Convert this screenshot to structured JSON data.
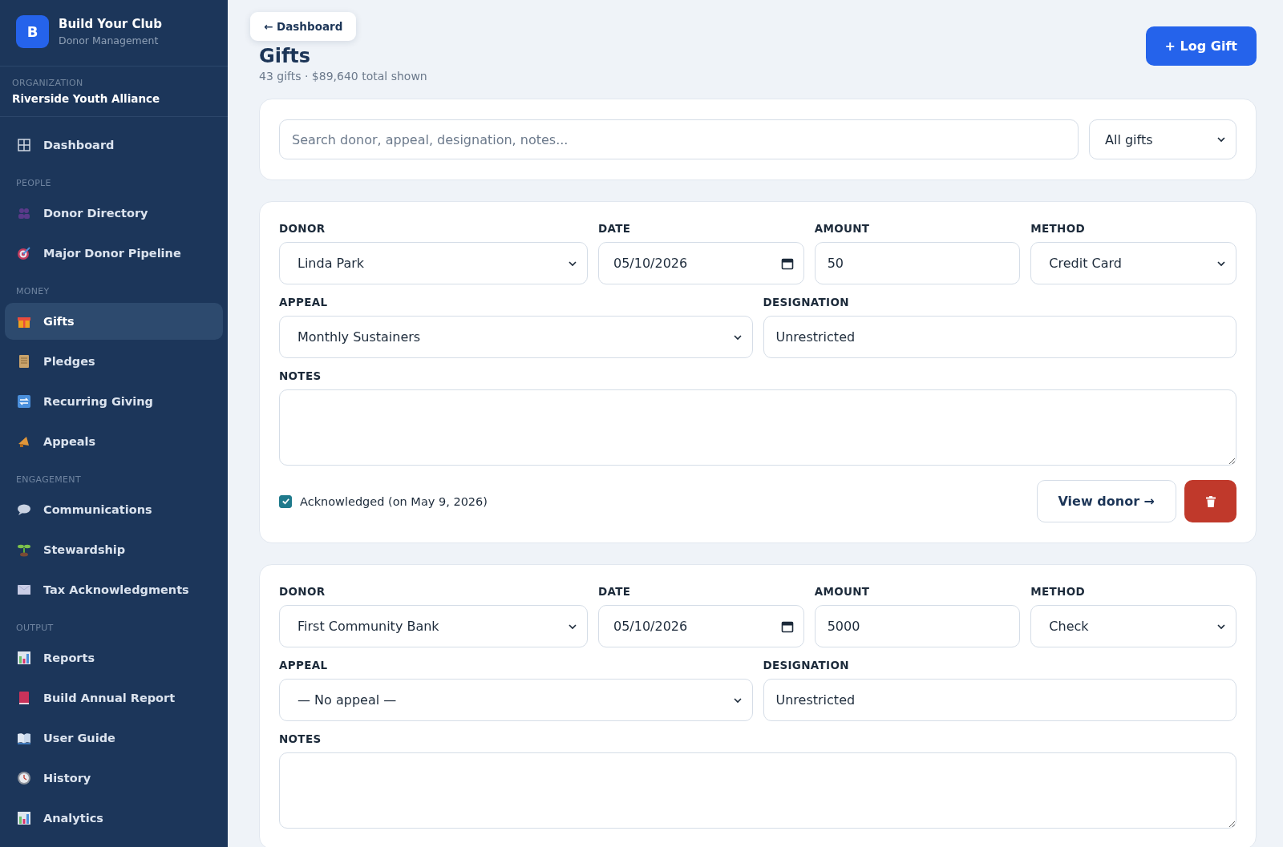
{
  "sidebar": {
    "brand": {
      "logo": "B",
      "title": "Build Your Club",
      "subtitle": "Donor Management"
    },
    "organization": {
      "label": "ORGANIZATION",
      "name": "Riverside Youth Alliance"
    },
    "sections": [
      {
        "items": [
          {
            "label": "Dashboard",
            "selected": false
          }
        ]
      },
      {
        "heading": "PEOPLE",
        "items": [
          {
            "label": "Donor Directory",
            "selected": false
          },
          {
            "label": "Major Donor Pipeline",
            "selected": false
          }
        ]
      },
      {
        "heading": "MONEY",
        "items": [
          {
            "label": "Gifts",
            "selected": true
          },
          {
            "label": "Pledges",
            "selected": false
          },
          {
            "label": "Recurring Giving",
            "selected": false
          },
          {
            "label": "Appeals",
            "selected": false
          }
        ]
      },
      {
        "heading": "ENGAGEMENT",
        "items": [
          {
            "label": "Communications",
            "selected": false
          },
          {
            "label": "Stewardship",
            "selected": false
          },
          {
            "label": "Tax Acknowledgments",
            "selected": false
          }
        ]
      },
      {
        "heading": "OUTPUT",
        "items": [
          {
            "label": "Reports",
            "selected": false
          },
          {
            "label": "Build Annual Report",
            "selected": false
          },
          {
            "label": "User Guide",
            "selected": false
          },
          {
            "label": "History",
            "selected": false
          },
          {
            "label": "Analytics",
            "selected": false
          }
        ]
      }
    ]
  },
  "back_button": "← Dashboard",
  "header": {
    "title": "Gifts",
    "subtitle": "43 gifts · $89,640 total shown",
    "action": "+ Log Gift"
  },
  "filters": {
    "search_placeholder": "Search donor, appeal, designation, notes...",
    "filter": "All gifts"
  },
  "gifts": [
    {
      "donor_label": "DONOR",
      "donor": "Linda Park",
      "date_label": "DATE",
      "date": "05/10/2026",
      "amount_label": "AMOUNT",
      "amount": "50",
      "method_label": "METHOD",
      "method": "Credit Card",
      "appeal_label": "APPEAL",
      "appeal": "Monthly Sustainers",
      "designation_label": "DESIGNATION",
      "designation": "Unrestricted",
      "notes_label": "NOTES",
      "acknowledgment": {
        "label": "Acknowledged (on May 9, 2026)",
        "checked": true
      },
      "view_button": "View donor →"
    },
    {
      "donor_label": "DONOR",
      "donor": "First Community Bank",
      "date_label": "DATE",
      "date": "05/10/2026",
      "amount_label": "AMOUNT",
      "amount": "5000",
      "method_label": "METHOD",
      "method": "Check",
      "appeal_label": "APPEAL",
      "appeal": "— No appeal —",
      "designation_label": "DESIGNATION",
      "designation": "Unrestricted",
      "notes_label": "NOTES"
    }
  ]
}
